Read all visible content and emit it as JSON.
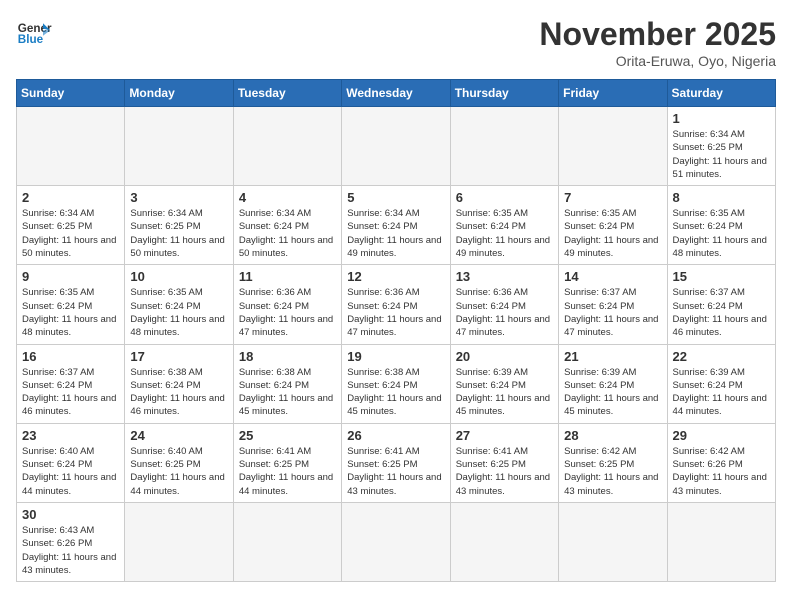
{
  "logo": {
    "text_general": "General",
    "text_blue": "Blue"
  },
  "title": "November 2025",
  "location": "Orita-Eruwa, Oyo, Nigeria",
  "days": [
    "Sunday",
    "Monday",
    "Tuesday",
    "Wednesday",
    "Thursday",
    "Friday",
    "Saturday"
  ],
  "weeks": [
    [
      {
        "date": "",
        "info": ""
      },
      {
        "date": "",
        "info": ""
      },
      {
        "date": "",
        "info": ""
      },
      {
        "date": "",
        "info": ""
      },
      {
        "date": "",
        "info": ""
      },
      {
        "date": "",
        "info": ""
      },
      {
        "date": "1",
        "info": "Sunrise: 6:34 AM\nSunset: 6:25 PM\nDaylight: 11 hours\nand 51 minutes."
      }
    ],
    [
      {
        "date": "2",
        "info": "Sunrise: 6:34 AM\nSunset: 6:25 PM\nDaylight: 11 hours\nand 50 minutes."
      },
      {
        "date": "3",
        "info": "Sunrise: 6:34 AM\nSunset: 6:25 PM\nDaylight: 11 hours\nand 50 minutes."
      },
      {
        "date": "4",
        "info": "Sunrise: 6:34 AM\nSunset: 6:24 PM\nDaylight: 11 hours\nand 50 minutes."
      },
      {
        "date": "5",
        "info": "Sunrise: 6:34 AM\nSunset: 6:24 PM\nDaylight: 11 hours\nand 49 minutes."
      },
      {
        "date": "6",
        "info": "Sunrise: 6:35 AM\nSunset: 6:24 PM\nDaylight: 11 hours\nand 49 minutes."
      },
      {
        "date": "7",
        "info": "Sunrise: 6:35 AM\nSunset: 6:24 PM\nDaylight: 11 hours\nand 49 minutes."
      },
      {
        "date": "8",
        "info": "Sunrise: 6:35 AM\nSunset: 6:24 PM\nDaylight: 11 hours\nand 48 minutes."
      }
    ],
    [
      {
        "date": "9",
        "info": "Sunrise: 6:35 AM\nSunset: 6:24 PM\nDaylight: 11 hours\nand 48 minutes."
      },
      {
        "date": "10",
        "info": "Sunrise: 6:35 AM\nSunset: 6:24 PM\nDaylight: 11 hours\nand 48 minutes."
      },
      {
        "date": "11",
        "info": "Sunrise: 6:36 AM\nSunset: 6:24 PM\nDaylight: 11 hours\nand 47 minutes."
      },
      {
        "date": "12",
        "info": "Sunrise: 6:36 AM\nSunset: 6:24 PM\nDaylight: 11 hours\nand 47 minutes."
      },
      {
        "date": "13",
        "info": "Sunrise: 6:36 AM\nSunset: 6:24 PM\nDaylight: 11 hours\nand 47 minutes."
      },
      {
        "date": "14",
        "info": "Sunrise: 6:37 AM\nSunset: 6:24 PM\nDaylight: 11 hours\nand 47 minutes."
      },
      {
        "date": "15",
        "info": "Sunrise: 6:37 AM\nSunset: 6:24 PM\nDaylight: 11 hours\nand 46 minutes."
      }
    ],
    [
      {
        "date": "16",
        "info": "Sunrise: 6:37 AM\nSunset: 6:24 PM\nDaylight: 11 hours\nand 46 minutes."
      },
      {
        "date": "17",
        "info": "Sunrise: 6:38 AM\nSunset: 6:24 PM\nDaylight: 11 hours\nand 46 minutes."
      },
      {
        "date": "18",
        "info": "Sunrise: 6:38 AM\nSunset: 6:24 PM\nDaylight: 11 hours\nand 45 minutes."
      },
      {
        "date": "19",
        "info": "Sunrise: 6:38 AM\nSunset: 6:24 PM\nDaylight: 11 hours\nand 45 minutes."
      },
      {
        "date": "20",
        "info": "Sunrise: 6:39 AM\nSunset: 6:24 PM\nDaylight: 11 hours\nand 45 minutes."
      },
      {
        "date": "21",
        "info": "Sunrise: 6:39 AM\nSunset: 6:24 PM\nDaylight: 11 hours\nand 45 minutes."
      },
      {
        "date": "22",
        "info": "Sunrise: 6:39 AM\nSunset: 6:24 PM\nDaylight: 11 hours\nand 44 minutes."
      }
    ],
    [
      {
        "date": "23",
        "info": "Sunrise: 6:40 AM\nSunset: 6:24 PM\nDaylight: 11 hours\nand 44 minutes."
      },
      {
        "date": "24",
        "info": "Sunrise: 6:40 AM\nSunset: 6:25 PM\nDaylight: 11 hours\nand 44 minutes."
      },
      {
        "date": "25",
        "info": "Sunrise: 6:41 AM\nSunset: 6:25 PM\nDaylight: 11 hours\nand 44 minutes."
      },
      {
        "date": "26",
        "info": "Sunrise: 6:41 AM\nSunset: 6:25 PM\nDaylight: 11 hours\nand 43 minutes."
      },
      {
        "date": "27",
        "info": "Sunrise: 6:41 AM\nSunset: 6:25 PM\nDaylight: 11 hours\nand 43 minutes."
      },
      {
        "date": "28",
        "info": "Sunrise: 6:42 AM\nSunset: 6:25 PM\nDaylight: 11 hours\nand 43 minutes."
      },
      {
        "date": "29",
        "info": "Sunrise: 6:42 AM\nSunset: 6:26 PM\nDaylight: 11 hours\nand 43 minutes."
      }
    ],
    [
      {
        "date": "30",
        "info": "Sunrise: 6:43 AM\nSunset: 6:26 PM\nDaylight: 11 hours\nand 43 minutes."
      },
      {
        "date": "",
        "info": ""
      },
      {
        "date": "",
        "info": ""
      },
      {
        "date": "",
        "info": ""
      },
      {
        "date": "",
        "info": ""
      },
      {
        "date": "",
        "info": ""
      },
      {
        "date": "",
        "info": ""
      }
    ]
  ]
}
